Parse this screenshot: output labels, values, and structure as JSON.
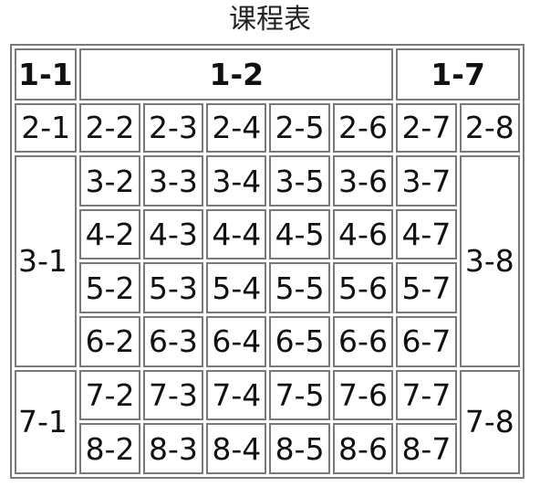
{
  "caption": "课程表",
  "header": {
    "c1": "1-1",
    "c2": "1-2",
    "c3": "1-7"
  },
  "row2": [
    "2-1",
    "2-2",
    "2-3",
    "2-4",
    "2-5",
    "2-6",
    "2-7",
    "2-8"
  ],
  "group1": {
    "left": "3-1",
    "right": "3-8",
    "rows": [
      [
        "3-2",
        "3-3",
        "3-4",
        "3-5",
        "3-6",
        "3-7"
      ],
      [
        "4-2",
        "4-3",
        "4-4",
        "4-5",
        "4-6",
        "4-7"
      ],
      [
        "5-2",
        "5-3",
        "5-4",
        "5-5",
        "5-6",
        "5-7"
      ],
      [
        "6-2",
        "6-3",
        "6-4",
        "6-5",
        "6-6",
        "6-7"
      ]
    ]
  },
  "group2": {
    "left": "7-1",
    "right": "7-8",
    "rows": [
      [
        "7-2",
        "7-3",
        "7-4",
        "7-5",
        "7-6",
        "7-7"
      ],
      [
        "8-2",
        "8-3",
        "8-4",
        "8-5",
        "8-6",
        "8-7"
      ]
    ]
  }
}
